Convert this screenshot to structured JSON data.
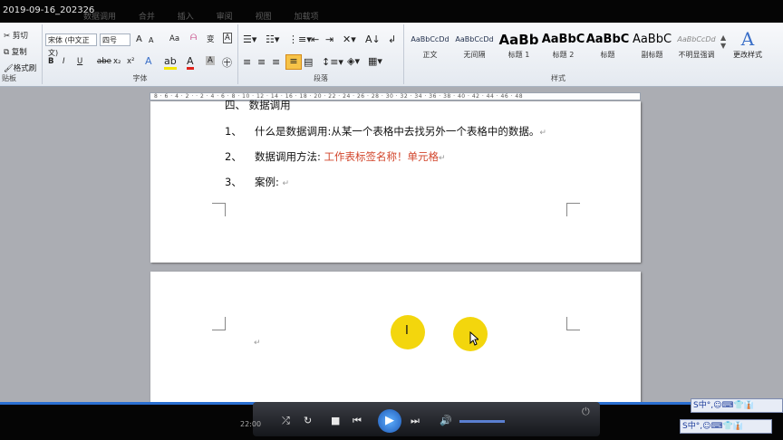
{
  "window": {
    "title": "2019-09-16_202326",
    "menu_tabs": [
      "数据调用",
      "合并",
      "插入",
      "审阅",
      "视图",
      "加载项"
    ]
  },
  "ribbon": {
    "clipboard": {
      "cut": "剪切",
      "copy": "复制",
      "format_painter": "格式刷",
      "label": "贴板"
    },
    "font": {
      "font_name": "宋体 (中文正文)",
      "font_size": "四号",
      "grow": "A",
      "shrink": "A",
      "case": "Aa",
      "clear": "ᗩ",
      "phonetic": "变",
      "border_char": "A",
      "bold": "B",
      "italic": "I",
      "underline": "U",
      "strike": "abe",
      "subscript": "x₂",
      "superscript": "x²",
      "label": "字体"
    },
    "paragraph": {
      "label": "段落"
    },
    "styles": {
      "label": "样式",
      "items": [
        {
          "preview": "AaBbCcDd",
          "name": "正文"
        },
        {
          "preview": "AaBbCcDd",
          "name": "无间隔"
        },
        {
          "preview": "AaBb",
          "name": "标题 1"
        },
        {
          "preview": "AaBbC",
          "name": "标题 2"
        },
        {
          "preview": "AaBbC",
          "name": "标题"
        },
        {
          "preview": "AaBbC",
          "name": "副标题"
        },
        {
          "preview": "AaBbCcDd",
          "name": "不明显强调"
        }
      ],
      "change_styles": "更改样式",
      "change_icon": "A"
    }
  },
  "ruler": {
    "ticks": "8 · 6 · 4 · 2 ·   · 2 · 4 · 6 · 8 · 10 · 12 · 14 · 16 · 18 · 20 · 22 · 24 · 26 · 28 · 30 · 32 · 34 · 36 · 38 · 40 · 42 · 44 · 46 · 48"
  },
  "document": {
    "heading": "四、 数据调用",
    "items": [
      {
        "num": "1、",
        "text": "什么是数据调用:从某一个表格中去找另外一个表格中的数据。"
      },
      {
        "num": "2、",
        "text": "数据调用方法: ",
        "highlight": "工作表标签名称！单元格"
      },
      {
        "num": "3、",
        "text": "案例: "
      }
    ],
    "paragraph_mark": "↵"
  },
  "player": {
    "time": "22:00"
  },
  "ime": {
    "label": "S中°,☺⌨👕👔"
  }
}
